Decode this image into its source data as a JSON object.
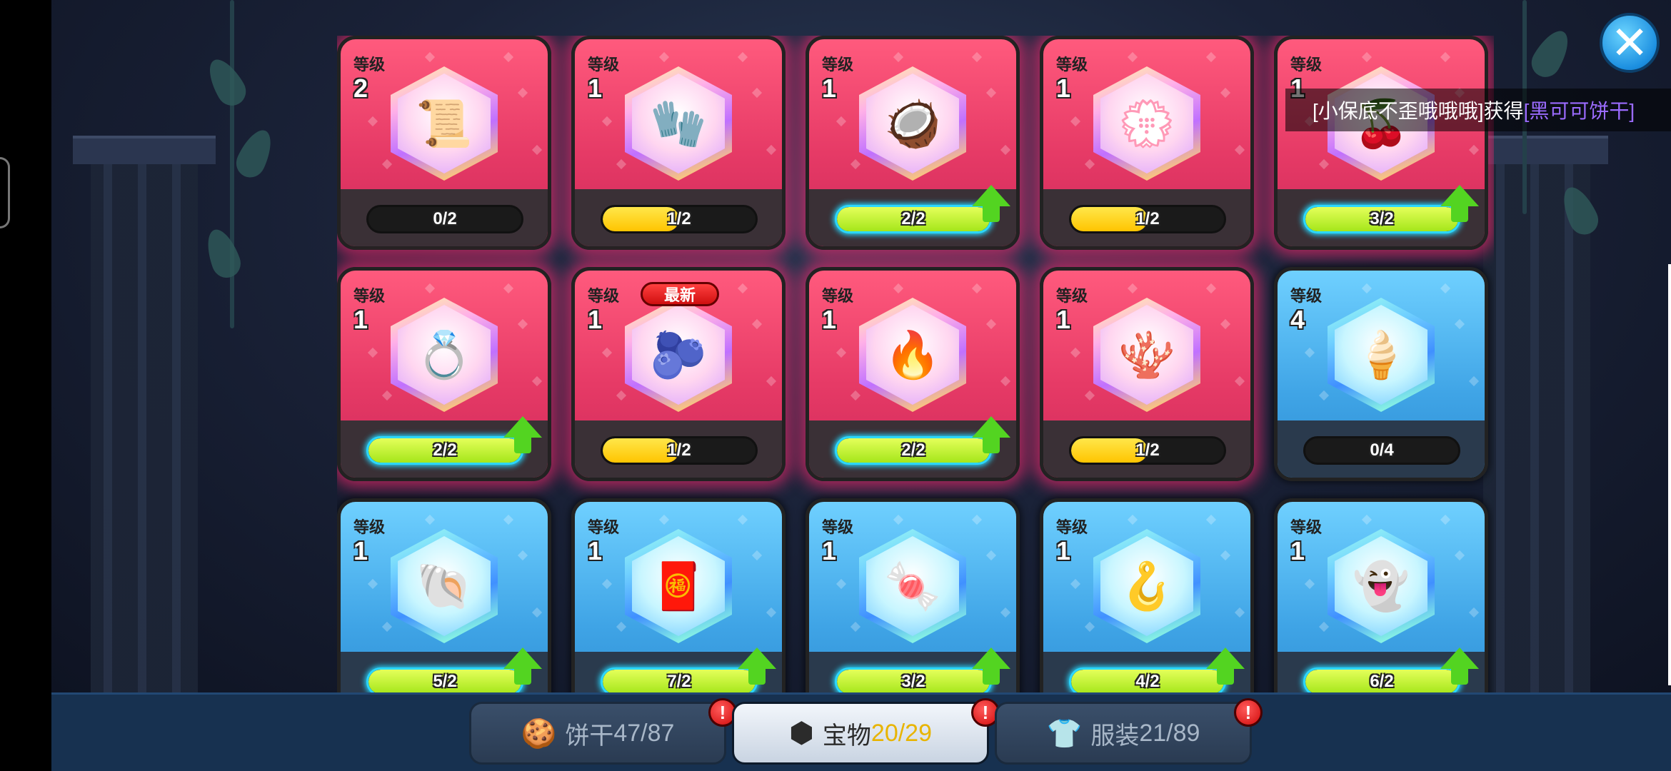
{
  "close_glyph": "✕",
  "notice": {
    "prefix": "[小保底不歪哦哦哦]获得",
    "highlight": "[黑可可饼干]"
  },
  "level_label": "等级",
  "new_badge": "最新",
  "rows": [
    [
      {
        "color": "red",
        "level": "2",
        "progress": "0/2",
        "fill": 0,
        "upgrade": false,
        "icon": "treasure-scroll-icon",
        "glyph": "📜"
      },
      {
        "color": "red",
        "level": "1",
        "progress": "1/2",
        "fill": 0.5,
        "upgrade": false,
        "icon": "lace-glove-icon",
        "glyph": "🧤"
      },
      {
        "color": "red",
        "level": "1",
        "progress": "2/2",
        "fill": 1,
        "upgrade": true,
        "icon": "coconut-drink-icon",
        "glyph": "🥥"
      },
      {
        "color": "red",
        "level": "1",
        "progress": "1/2",
        "fill": 0.5,
        "upgrade": false,
        "icon": "flower-wreath-icon",
        "glyph": "💮"
      },
      {
        "color": "red",
        "level": "1",
        "progress": "3/2",
        "fill": 1,
        "upgrade": true,
        "icon": "cherry-wreath-icon",
        "glyph": "🍒"
      }
    ],
    [
      {
        "color": "red",
        "level": "1",
        "progress": "2/2",
        "fill": 1,
        "upgrade": true,
        "icon": "pink-ring-icon",
        "glyph": "💍"
      },
      {
        "color": "red",
        "level": "1",
        "progress": "1/2",
        "fill": 0.5,
        "upgrade": false,
        "icon": "dark-berry-icon",
        "glyph": "🫐",
        "new": true
      },
      {
        "color": "red",
        "level": "1",
        "progress": "2/2",
        "fill": 1,
        "upgrade": true,
        "icon": "fire-crown-icon",
        "glyph": "🔥"
      },
      {
        "color": "red",
        "level": "1",
        "progress": "1/2",
        "fill": 0.5,
        "upgrade": false,
        "icon": "coral-icon",
        "glyph": "🪸"
      },
      {
        "color": "blue",
        "level": "4",
        "progress": "0/4",
        "fill": 0,
        "upgrade": false,
        "icon": "ice-cream-cone-icon",
        "glyph": "🍦"
      }
    ],
    [
      {
        "color": "blue",
        "level": "1",
        "progress": "5/2",
        "fill": 1,
        "upgrade": true,
        "icon": "spiral-shell-icon",
        "glyph": "🐚"
      },
      {
        "color": "blue",
        "level": "1",
        "progress": "7/2",
        "fill": 1,
        "upgrade": true,
        "icon": "red-scroll-icon",
        "glyph": "🧧"
      },
      {
        "color": "blue",
        "level": "1",
        "progress": "3/2",
        "fill": 1,
        "upgrade": true,
        "icon": "candy-icon",
        "glyph": "🍬"
      },
      {
        "color": "blue",
        "level": "1",
        "progress": "4/2",
        "fill": 1,
        "upgrade": true,
        "icon": "scythe-icon",
        "glyph": "🪝"
      },
      {
        "color": "blue",
        "level": "1",
        "progress": "6/2",
        "fill": 1,
        "upgrade": true,
        "icon": "ghost-cloth-icon",
        "glyph": "👻"
      }
    ]
  ],
  "tabs": [
    {
      "label": "饼干",
      "count": "47/87",
      "icon": "cookie-icon",
      "glyph": "🍪",
      "active": false,
      "alert": "!"
    },
    {
      "label": "宝物",
      "count": "20/29",
      "icon": "treasure-gem-icon",
      "glyph": "⬢",
      "active": true,
      "alert": "!"
    },
    {
      "label": "服装",
      "count": "21/89",
      "icon": "shirt-icon",
      "glyph": "👕",
      "active": false,
      "alert": "!"
    }
  ]
}
